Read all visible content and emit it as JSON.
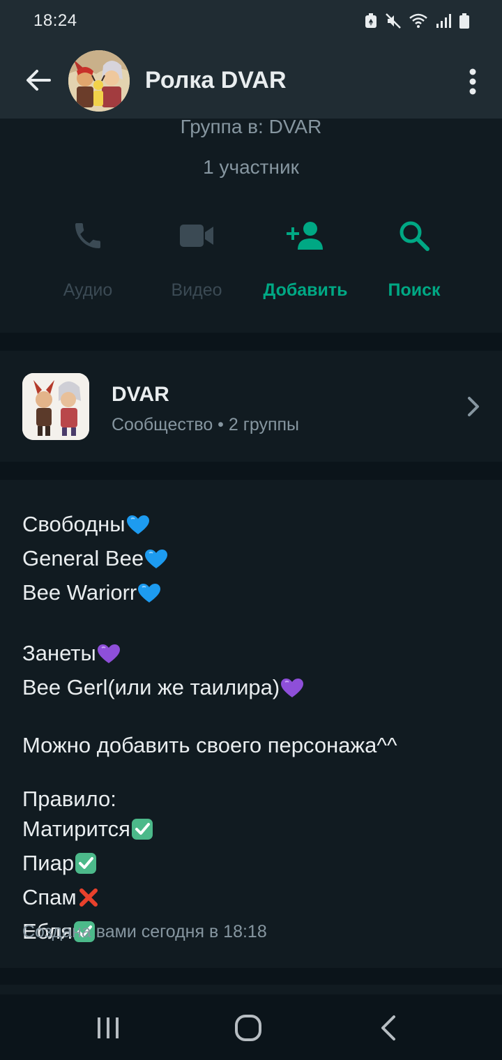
{
  "status_bar": {
    "time": "18:24"
  },
  "header": {
    "title": "Ролка DVAR"
  },
  "info": {
    "group_in": "Группа в: DVAR",
    "members": "1 участник",
    "actions": [
      {
        "label": "Аудио",
        "icon": "phone-icon"
      },
      {
        "label": "Видео",
        "icon": "video-icon"
      },
      {
        "label": "Добавить",
        "icon": "add-person-icon"
      },
      {
        "label": "Поиск",
        "icon": "search-icon"
      }
    ]
  },
  "community": {
    "name": "DVAR",
    "subtitle": "Сообщество • 2 группы"
  },
  "description": {
    "lines": [
      "Свободны",
      "General Bee",
      "Bee Wariorr",
      "Занеты",
      "Bee Gerl(или же таилира)",
      "Можно добавить своего персонажа^^",
      "Правило:",
      "Матирится",
      "Пиар",
      "Спам",
      "Ебля"
    ],
    "created": "Создана вами сегодня в 18:18"
  },
  "colors": {
    "accent": "#00a884",
    "header_bg": "#202c33",
    "card_bg": "#111b21",
    "page_bg": "#0b141a",
    "muted_text": "#8696a0"
  }
}
